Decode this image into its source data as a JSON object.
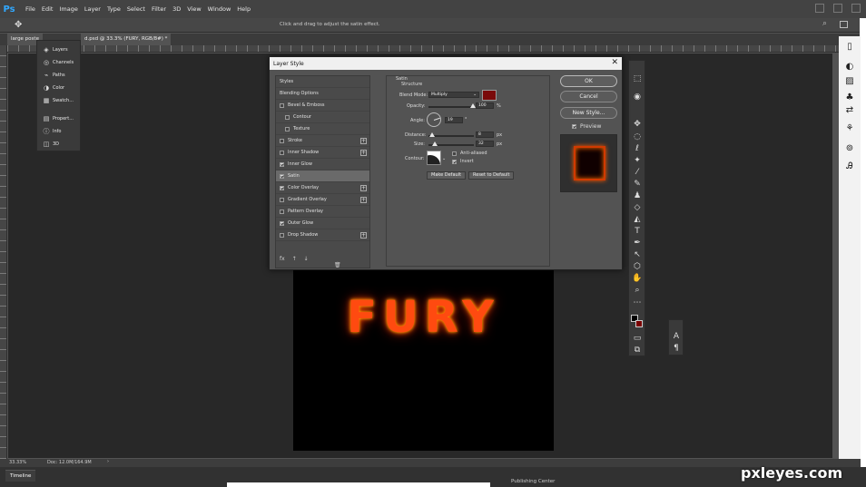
{
  "app": {
    "logo": "Ps"
  },
  "menu": [
    "File",
    "Edit",
    "Image",
    "Layer",
    "Type",
    "Select",
    "Filter",
    "3D",
    "View",
    "Window",
    "Help"
  ],
  "options_bar": {
    "hint": "Click and drag to adjust the satin effect."
  },
  "tabs": [
    {
      "label": "large poste"
    },
    {
      "label": "d.psd @ 33.3% (FURY, RGB/8#) *"
    }
  ],
  "panels": [
    {
      "label": "Layers",
      "icon": "layers-icon"
    },
    {
      "label": "Channels",
      "icon": "channels-icon"
    },
    {
      "label": "Paths",
      "icon": "paths-icon"
    },
    {
      "label": "Color",
      "icon": "color-icon"
    },
    {
      "label": "Swatch...",
      "icon": "swatches-icon"
    },
    {
      "label": "Propert...",
      "icon": "properties-icon"
    },
    {
      "label": "Info",
      "icon": "info-icon"
    },
    {
      "label": "3D",
      "icon": "3d-icon"
    }
  ],
  "canvas": {
    "text": "FURY"
  },
  "status": {
    "zoom": "33.33%",
    "doc": "Doc: 12.0M/164.9M"
  },
  "timeline": {
    "label": "Timeline"
  },
  "bottom_text": "Publishing Center",
  "watermark": "pxleyes.com",
  "dialog": {
    "title": "Layer Style",
    "styles": [
      {
        "label": "Styles",
        "type": "header"
      },
      {
        "label": "Blending Options",
        "type": "header"
      },
      {
        "label": "Bevel & Emboss",
        "checked": false
      },
      {
        "label": "Contour",
        "checked": false,
        "indent": true
      },
      {
        "label": "Texture",
        "checked": false,
        "indent": true
      },
      {
        "label": "Stroke",
        "checked": false,
        "plus": true
      },
      {
        "label": "Inner Shadow",
        "checked": false,
        "plus": true
      },
      {
        "label": "Inner Glow",
        "checked": true
      },
      {
        "label": "Satin",
        "checked": true,
        "active": true
      },
      {
        "label": "Color Overlay",
        "checked": true,
        "plus": true
      },
      {
        "label": "Gradient Overlay",
        "checked": false,
        "plus": true
      },
      {
        "label": "Pattern Overlay",
        "checked": false
      },
      {
        "label": "Outer Glow",
        "checked": true
      },
      {
        "label": "Drop Shadow",
        "checked": false,
        "plus": true
      }
    ],
    "fx_label": "fx",
    "satin": {
      "group_title": "Satin",
      "structure_title": "Structure",
      "blend_mode_label": "Blend Mode:",
      "blend_mode_value": "Multiply",
      "blend_color": "#7a0a0a",
      "opacity_label": "Opacity:",
      "opacity_value": "100",
      "opacity_unit": "%",
      "angle_label": "Angle:",
      "angle_value": "19",
      "angle_unit": "°",
      "distance_label": "Distance:",
      "distance_value": "8",
      "distance_unit": "px",
      "size_label": "Size:",
      "size_value": "32",
      "size_unit": "px",
      "contour_label": "Contour:",
      "antialiased_label": "Anti-aliased",
      "invert_label": "Invert",
      "make_default": "Make Default",
      "reset_default": "Reset to Default"
    },
    "buttons": {
      "ok": "OK",
      "cancel": "Cancel",
      "new_style": "New Style...",
      "preview": "Preview"
    }
  }
}
